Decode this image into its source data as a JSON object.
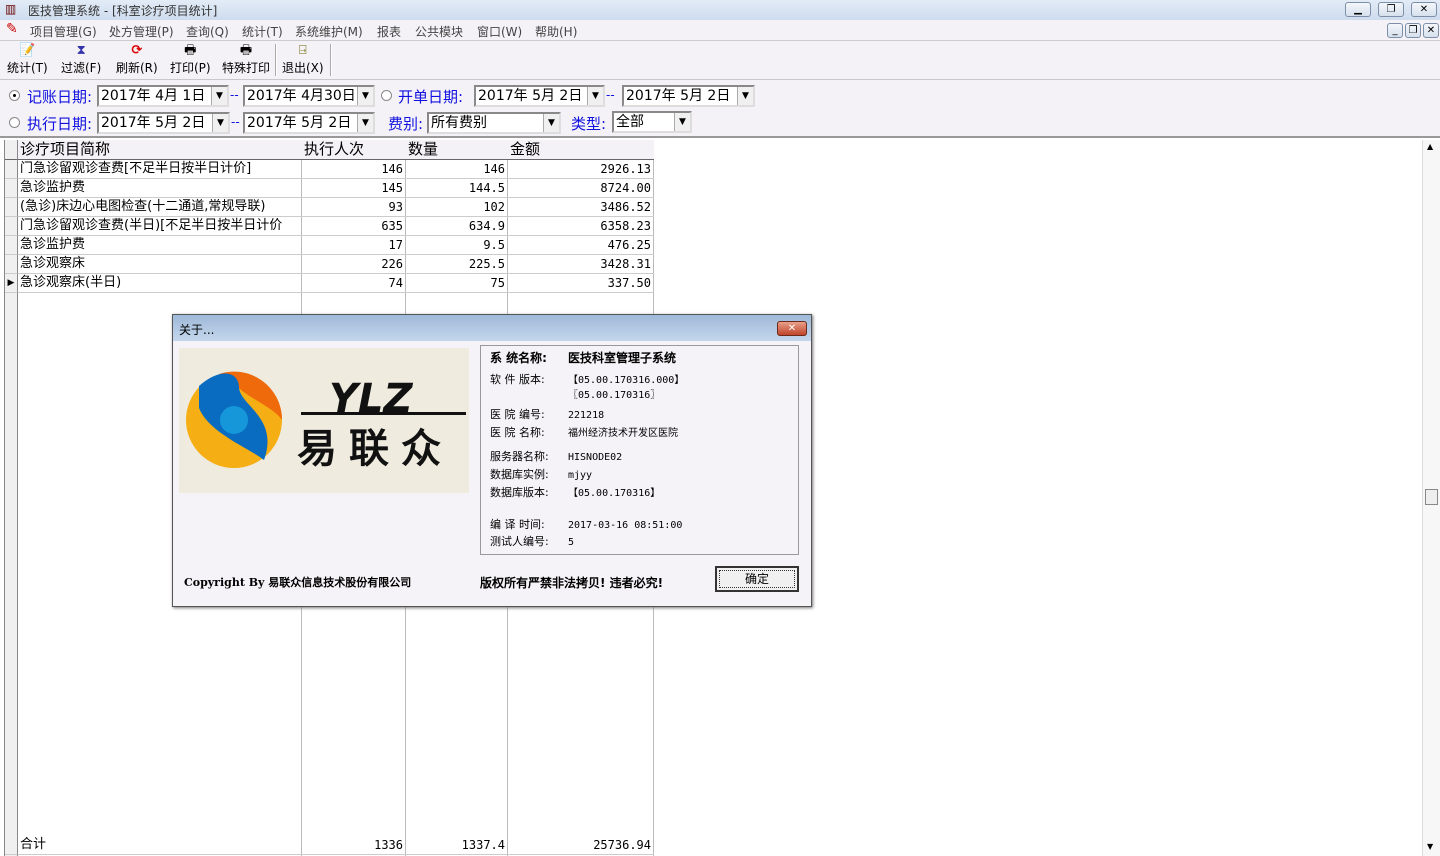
{
  "window": {
    "title": "医技管理系统 - [科室诊疗项目统计]",
    "controls": [
      "minimize",
      "restore",
      "close"
    ]
  },
  "menu": [
    "项目管理(G)",
    "处方管理(P)",
    "查询(Q)",
    "统计(T)",
    "系统维护(M)",
    "报表",
    "公共模块",
    "窗口(W)",
    "帮助(H)"
  ],
  "toolbar": [
    {
      "label": "统计(T)",
      "icon": "stats-icon"
    },
    {
      "label": "过滤(F)",
      "icon": "hourglass-icon"
    },
    {
      "label": "刷新(R)",
      "icon": "refresh-icon"
    },
    {
      "label": "打印(P)",
      "icon": "printer-icon"
    },
    {
      "label": "特殊打印",
      "icon": "printer-icon"
    },
    {
      "label": "退出(X)",
      "icon": "exit-icon"
    }
  ],
  "filters": {
    "bookkeeping_date": {
      "label": "记账日期:",
      "selected": true,
      "from": "2017年 4月 1日",
      "to": "2017年 4月30日"
    },
    "order_date": {
      "label": "开单日期:",
      "selected": false,
      "from": "2017年 5月 2日",
      "to": "2017年 5月 2日"
    },
    "exec_date": {
      "label": "执行日期:",
      "selected": false,
      "from": "2017年 5月 2日",
      "to": "2017年 5月 2日"
    },
    "fee_type": {
      "label": "费别:",
      "value": "所有费别"
    },
    "category": {
      "label": "类型:",
      "value": "全部"
    },
    "sep": "--"
  },
  "table": {
    "columns": [
      "诊疗项目简称",
      "执行人次",
      "数量",
      "金额"
    ],
    "rows": [
      [
        "门急诊留观诊查费[不足半日按半日计价]",
        "146",
        "146",
        "2926.13"
      ],
      [
        "急诊监护费",
        "145",
        "144.5",
        "8724.00"
      ],
      [
        "(急诊)床边心电图检查(十二通道,常规导联)",
        "93",
        "102",
        "3486.52"
      ],
      [
        "门急诊留观诊查费(半日)[不足半日按半日计价",
        "635",
        "634.9",
        "6358.23"
      ],
      [
        "急诊监护费",
        "17",
        "9.5",
        "476.25"
      ],
      [
        "急诊观察床",
        "226",
        "225.5",
        "3428.31"
      ],
      [
        "急诊观察床(半日)",
        "74",
        "75",
        "337.50"
      ]
    ],
    "current_row": 6,
    "total": [
      "合计",
      "1336",
      "1337.4",
      "25736.94"
    ]
  },
  "dialog": {
    "title": "关于...",
    "logo_text": {
      "latin": "YLZ",
      "cn": "易联众"
    },
    "info": [
      {
        "k": "系 统名称:",
        "v": "医技科室管理子系统",
        "bold": true
      },
      {
        "k": "软 件 版本:",
        "v": "【05.00.170316.000】"
      },
      {
        "k": "",
        "v": "〖05.00.170316〗"
      },
      {
        "k": "医 院 编号:",
        "v": "221218"
      },
      {
        "k": "医 院 名称:",
        "v": "福州经济技术开发区医院"
      },
      {
        "k": "服务器名称:",
        "v": "HISNODE02"
      },
      {
        "k": "数据库实例:",
        "v": "mjyy"
      },
      {
        "k": "数据库版本:",
        "v": "【05.00.170316】"
      },
      {
        "k": "编 译 时间:",
        "v": "2017-03-16  08:51:00"
      },
      {
        "k": "测试人编号:",
        "v": "5"
      }
    ],
    "copyright": "Copyright By 易联众信息技术股份有限公司",
    "notice": "版权所有严禁非法拷贝!  违者必究!",
    "ok_label": "确定"
  }
}
